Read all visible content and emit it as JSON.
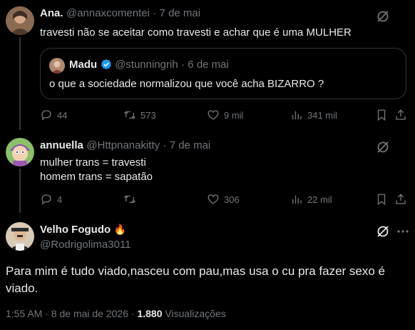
{
  "tweet1": {
    "name": "Ana.",
    "handle": "@annaxcomentei",
    "date": "· 7 de mai",
    "text": "travesti não se aceitar como travesti e achar que é uma MULHER",
    "quote": {
      "name": "Madu",
      "handle": "@stunningrih",
      "date": "· 6 de mai",
      "text": "o que a sociedade normalizou que você acha BIZARRO ?"
    },
    "replies": "44",
    "retweets": "573",
    "likes": "9 mil",
    "views": "341 mil"
  },
  "tweet2": {
    "name": "annuella",
    "handle": "@Httpnanakitty",
    "date": "· 7 de mai",
    "line1": "mulher trans = travesti",
    "line2": "homem trans = sapatão",
    "replies": "4",
    "retweets": "",
    "likes": "306",
    "views": "22 mil"
  },
  "tweet3": {
    "name": "Velho Fogudo",
    "emoji": "🔥",
    "handle": "@Rodrigolima3011",
    "text": "Para mim é tudo viado,nasceu com pau,mas usa o cu pra fazer sexo é viado.",
    "time": "1:55 AM · 8 de mai de 2026 ·",
    "views_count": "1.880",
    "views_label": "Visualizações"
  },
  "colors": {
    "background": "#000000",
    "text": "#e7e9ea",
    "muted": "#71767b",
    "border": "#2f3336",
    "verified": "#1d9bf0"
  },
  "icons": [
    "grok-icon",
    "reply-icon",
    "retweet-icon",
    "like-icon",
    "views-icon",
    "bookmark-icon",
    "share-icon",
    "verified-badge-icon",
    "fire-emoji"
  ]
}
